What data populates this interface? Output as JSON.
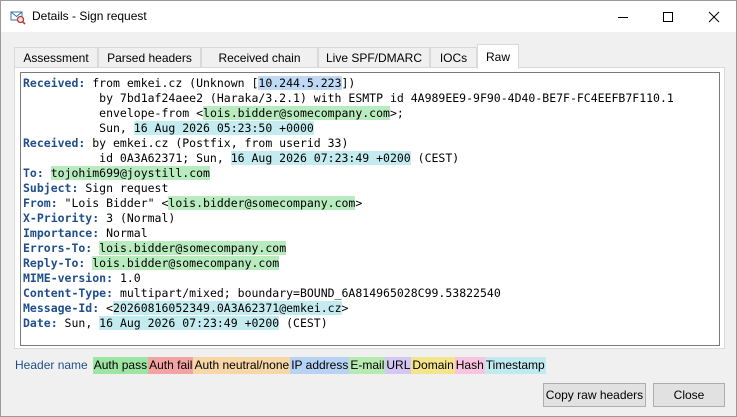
{
  "window": {
    "title": "Details - Sign request",
    "icon": "envelope-magnifier-icon"
  },
  "tabs": [
    {
      "label": "Assessment",
      "active": false
    },
    {
      "label": "Parsed headers",
      "active": false
    },
    {
      "label": "Received chain",
      "active": false
    },
    {
      "label": "Live SPF/DMARC",
      "active": false
    },
    {
      "label": "IOCs",
      "active": false
    },
    {
      "label": "Raw",
      "active": true
    }
  ],
  "raw_lines": [
    [
      {
        "t": "Received:",
        "c": "hn"
      },
      {
        "t": " from emkei.cz (Unknown ["
      },
      {
        "t": "10.244.5.223",
        "c": "hl-ip"
      },
      {
        "t": "])"
      }
    ],
    [
      {
        "t": "           by 7bd1af24aee2 (Haraka/3.2.1) with ESMTP id 4A989EE9-9F90-4D40-BE7F-FC4EEFB7F110.1"
      }
    ],
    [
      {
        "t": "           envelope-from <"
      },
      {
        "t": "lois.bidder@somecompany.com",
        "c": "hl-email"
      },
      {
        "t": ">;"
      }
    ],
    [
      {
        "t": "           Sun, "
      },
      {
        "t": "16 Aug 2026 05:23:50 +0000",
        "c": "hl-ts"
      }
    ],
    [
      {
        "t": "Received:",
        "c": "hn"
      },
      {
        "t": " by emkei.cz (Postfix, from userid 33)"
      }
    ],
    [
      {
        "t": "           id 0A3A62371; Sun, "
      },
      {
        "t": "16 Aug 2026 07:23:49 +0200",
        "c": "hl-ts"
      },
      {
        "t": " (CEST)"
      }
    ],
    [
      {
        "t": "To:",
        "c": "hn"
      },
      {
        "t": " "
      },
      {
        "t": "tojohim699@joystill.com",
        "c": "hl-email"
      }
    ],
    [
      {
        "t": "Subject:",
        "c": "hn"
      },
      {
        "t": " Sign request"
      }
    ],
    [
      {
        "t": "From:",
        "c": "hn"
      },
      {
        "t": " \"Lois Bidder\" <"
      },
      {
        "t": "lois.bidder@somecompany.com",
        "c": "hl-email"
      },
      {
        "t": ">"
      }
    ],
    [
      {
        "t": "X-Priority:",
        "c": "hn"
      },
      {
        "t": " 3 (Normal)"
      }
    ],
    [
      {
        "t": "Importance:",
        "c": "hn"
      },
      {
        "t": " Normal"
      }
    ],
    [
      {
        "t": "Errors-To:",
        "c": "hn"
      },
      {
        "t": " "
      },
      {
        "t": "lois.bidder@somecompany.com",
        "c": "hl-email"
      }
    ],
    [
      {
        "t": "Reply-To:",
        "c": "hn"
      },
      {
        "t": " "
      },
      {
        "t": "lois.bidder@somecompany.com",
        "c": "hl-email"
      }
    ],
    [
      {
        "t": "MIME-version:",
        "c": "hn"
      },
      {
        "t": " 1.0"
      }
    ],
    [
      {
        "t": "Content-Type:",
        "c": "hn"
      },
      {
        "t": " multipart/mixed; boundary=BOUND_6A814965028C99.53822540"
      }
    ],
    [
      {
        "t": "Message-Id:",
        "c": "hn"
      },
      {
        "t": " <"
      },
      {
        "t": "20260816052349.0A3A62371@emkei.cz",
        "c": "hl-ts"
      },
      {
        "t": ">"
      }
    ],
    [
      {
        "t": "Date:",
        "c": "hn"
      },
      {
        "t": " Sun, "
      },
      {
        "t": "16 Aug 2026 07:23:49 +0200",
        "c": "hl-ts"
      },
      {
        "t": " (CEST)"
      }
    ]
  ],
  "legend": {
    "header_name": "Header name",
    "auth_pass": "Auth pass",
    "auth_fail": "Auth fail",
    "auth_neutral": "Auth neutral/none",
    "ip_address": "IP address",
    "email": "E-mail",
    "url": "URL",
    "domain": "Domain",
    "hash": "Hash",
    "timestamp": "Timestamp"
  },
  "buttons": {
    "copy_raw": "Copy raw headers",
    "close": "Close"
  }
}
